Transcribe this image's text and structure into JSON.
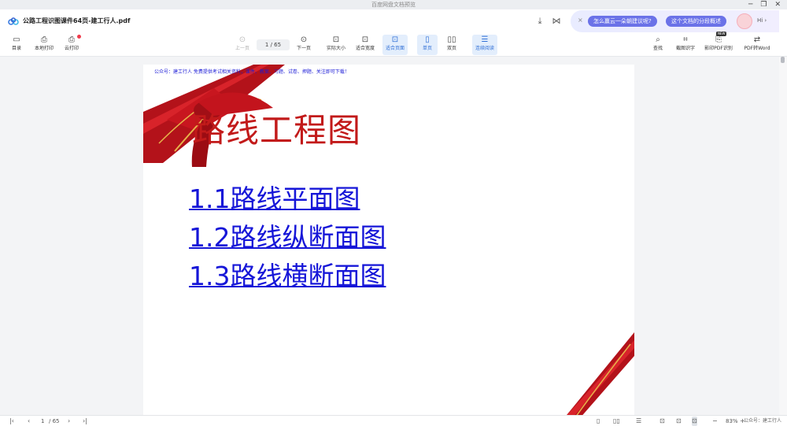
{
  "window": {
    "title": "百度网盘文档预览",
    "minimize": "─",
    "restore": "❐",
    "close": "✕"
  },
  "header": {
    "filename": "公路工程识图课件64页-建工行人.pdf",
    "download_icon": "download-icon",
    "share_icon": "share-icon"
  },
  "ai_bar": {
    "close": "×",
    "chip1": "怎么赢云一朵朝建议呢?",
    "chip2": "这个文档的分段概述",
    "hi": "Hi ›"
  },
  "toolbar": {
    "left": [
      {
        "label": "目录",
        "icon": "▭"
      },
      {
        "label": "本地打印",
        "icon": "⎙"
      },
      {
        "label": "云打印",
        "icon": "⎙"
      }
    ],
    "prev": {
      "label": "上一页",
      "icon": "⊙"
    },
    "page_current": "1",
    "page_total": "/ 65",
    "next": {
      "label": "下一页",
      "icon": "⊙"
    },
    "view": [
      {
        "label": "实际大小",
        "icon": "⊡"
      },
      {
        "label": "适合宽度",
        "icon": "⊡"
      },
      {
        "label": "适合页面",
        "icon": "⊡"
      },
      {
        "label": "单页",
        "icon": "▯"
      },
      {
        "label": "双页",
        "icon": "▯▯"
      },
      {
        "label": "连续阅读",
        "icon": "☰"
      }
    ],
    "right": [
      {
        "label": "查找",
        "icon": "⌕"
      },
      {
        "label": "截图识字",
        "icon": "⌗"
      },
      {
        "label": "影印PDF识别",
        "icon": "⎘",
        "tag": "NEW"
      },
      {
        "label": "PDF转Word",
        "icon": "⇄"
      }
    ]
  },
  "document": {
    "watermark": "公众号：建工行人 免费提供考试相关资料，课件、教案、习题、试卷、押题、关注即可下载！",
    "title": "路线工程图",
    "links": [
      "1.1路线平面图",
      "1.2路线纵断面图",
      "1.3路线横断面图"
    ]
  },
  "statusbar": {
    "page_current": "1",
    "page_total": "/ 65",
    "zoom": "83%",
    "zoom_minus": "−",
    "zoom_plus": "+",
    "brand": "公众号：建工行人"
  },
  "colors": {
    "accent": "#2f6fd6",
    "title_red": "#c21a1a",
    "link_blue": "#1616d8",
    "ribbon_red": "#b3121a",
    "ai_chip": "#6b72e8"
  }
}
